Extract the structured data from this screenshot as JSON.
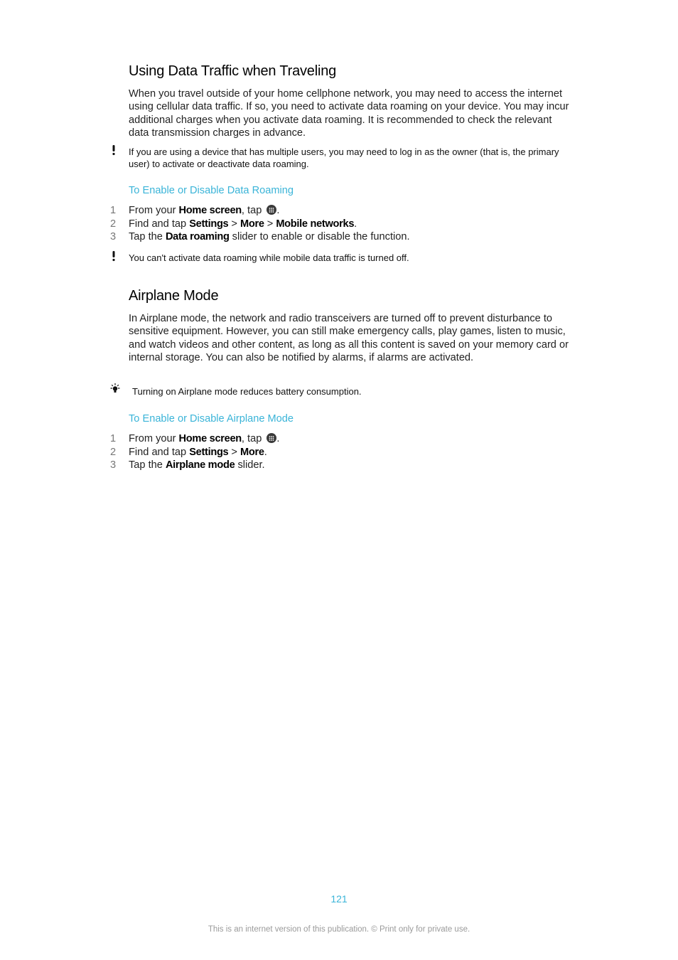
{
  "section1": {
    "title": "Using Data Traffic when Traveling",
    "paragraph": "When you travel outside of your home cellphone network, you may need to access the internet using cellular data traffic. If so, you need to activate data roaming on your device. You may incur additional charges when you activate data roaming. It is recommended to check the relevant data transmission charges in advance.",
    "note_icon": "exclamation-icon",
    "note": "If you are using a device that has multiple users, you may need to log in as the owner (that is, the primary user) to activate or deactivate data roaming.",
    "procedure_title": "To Enable or Disable Data Roaming",
    "steps": [
      {
        "num": "1",
        "pre": "From your ",
        "bold1": "Home screen",
        "mid1": ", tap ",
        "icon": "apps-grid-icon",
        "post": "."
      },
      {
        "num": "2",
        "pre": "Find and tap ",
        "bold1": "Settings",
        "mid1": " > ",
        "bold2": "More",
        "mid2": " > ",
        "bold3": "Mobile networks",
        "post": "."
      },
      {
        "num": "3",
        "pre": "Tap the ",
        "bold1": "Data roaming",
        "post": " slider to enable or disable the function."
      }
    ],
    "warning_icon": "exclamation-icon",
    "warning": "You can't activate data roaming while mobile data traffic is turned off."
  },
  "section2": {
    "title": "Airplane Mode",
    "paragraph": "In Airplane mode, the network and radio transceivers are turned off to prevent disturbance to sensitive equipment. However, you can still make emergency calls, play games, listen to music, and watch videos and other content, as long as all this content is saved on your memory card or internal storage. You can also be notified by alarms, if alarms are activated.",
    "tip_icon": "lightbulb-icon",
    "tip": "Turning on Airplane mode reduces battery consumption.",
    "procedure_title": "To Enable or Disable Airplane Mode",
    "steps": [
      {
        "num": "1",
        "pre": "From your ",
        "bold1": "Home screen",
        "mid1": ", tap ",
        "icon": "apps-grid-icon",
        "post": "."
      },
      {
        "num": "2",
        "pre": "Find and tap ",
        "bold1": "Settings",
        "mid1": " > ",
        "bold2": "More",
        "post": "."
      },
      {
        "num": "3",
        "pre": "Tap the ",
        "bold1": "Airplane mode",
        "post": " slider."
      }
    ]
  },
  "footer": {
    "page_number": "121",
    "notice": "This is an internet version of this publication. © Print only for private use."
  },
  "colors": {
    "accent": "#3ab4d8",
    "footer_text": "#9a9a9a"
  }
}
